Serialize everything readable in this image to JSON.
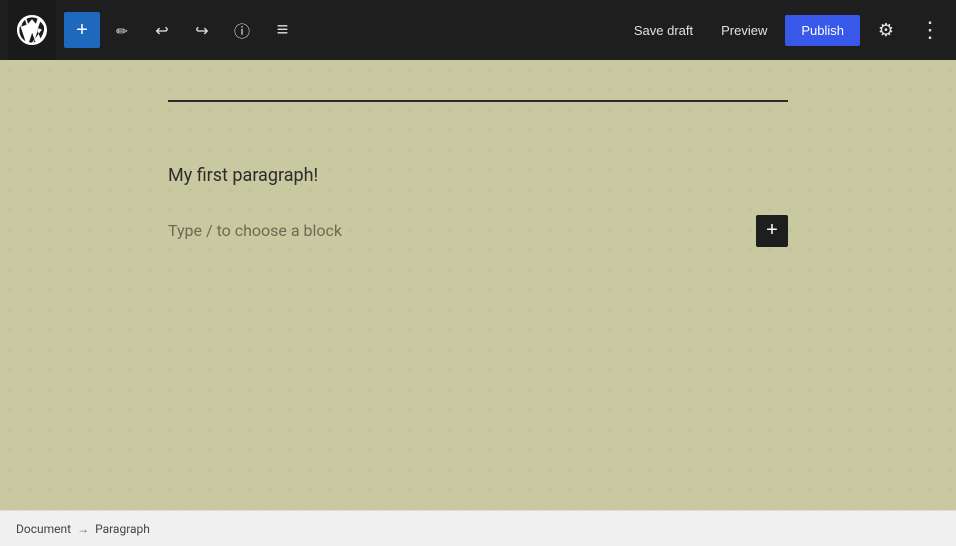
{
  "toolbar": {
    "wp_logo_label": "WordPress",
    "add_button_label": "+",
    "pencil_icon": "pencil-icon",
    "undo_icon": "undo-icon",
    "redo_icon": "redo-icon",
    "info_icon": "info-icon",
    "list_view_icon": "list-view-icon",
    "save_draft_label": "Save draft",
    "preview_label": "Preview",
    "publish_label": "Publish",
    "settings_icon": "settings-icon",
    "more_icon": "more-options-icon"
  },
  "editor": {
    "paragraph_text": "My first paragraph!",
    "placeholder_text": "Type / to choose a block",
    "add_block_label": "+"
  },
  "status_bar": {
    "document_label": "Document",
    "arrow": "→",
    "paragraph_label": "Paragraph"
  }
}
